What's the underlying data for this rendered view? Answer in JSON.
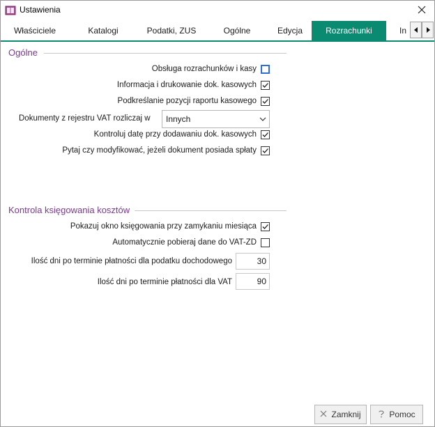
{
  "window": {
    "title": "Ustawienia"
  },
  "tabs": [
    {
      "label": "Właściciele",
      "active": false
    },
    {
      "label": "Katalogi",
      "active": false
    },
    {
      "label": "Podatki, ZUS",
      "active": false
    },
    {
      "label": "Ogólne",
      "active": false
    },
    {
      "label": "Edycja",
      "active": false
    },
    {
      "label": "Rozrachunki",
      "active": true
    },
    {
      "label": "In",
      "active": false
    }
  ],
  "section1": {
    "title": "Ogólne",
    "rows": [
      {
        "label": "Obsługa rozrachunków i kasy",
        "checked": false
      },
      {
        "label": "Informacja i drukowanie  dok. kasowych",
        "checked": true
      },
      {
        "label": "Podkreślanie pozycji raportu kasowego",
        "checked": true
      },
      {
        "label": "Kontroluj datę przy dodawaniu dok. kasowych",
        "checked": true
      },
      {
        "label": "Pytaj czy modyfikować, jeżeli dokument posiada spłaty",
        "checked": true
      }
    ],
    "select": {
      "label": "Dokumenty z rejestru VAT rozliczaj w",
      "value": "Innych"
    }
  },
  "section2": {
    "title": "Kontrola księgowania kosztów",
    "rows": [
      {
        "label": "Pokazuj okno księgowania przy zamykaniu miesiąca",
        "checked": true
      },
      {
        "label": "Automatycznie pobieraj dane do VAT-ZD",
        "checked": false
      }
    ],
    "numbers": [
      {
        "label": "Ilość dni po terminie płatności dla podatku dochodowego",
        "value": "30"
      },
      {
        "label": "Ilość dni po terminie płatności dla VAT",
        "value": "90"
      }
    ]
  },
  "buttons": {
    "close_label": "Zamknij",
    "help_label": "Pomoc"
  },
  "colors": {
    "accent": "#0a8a70",
    "section_title": "#7a3a8f"
  }
}
